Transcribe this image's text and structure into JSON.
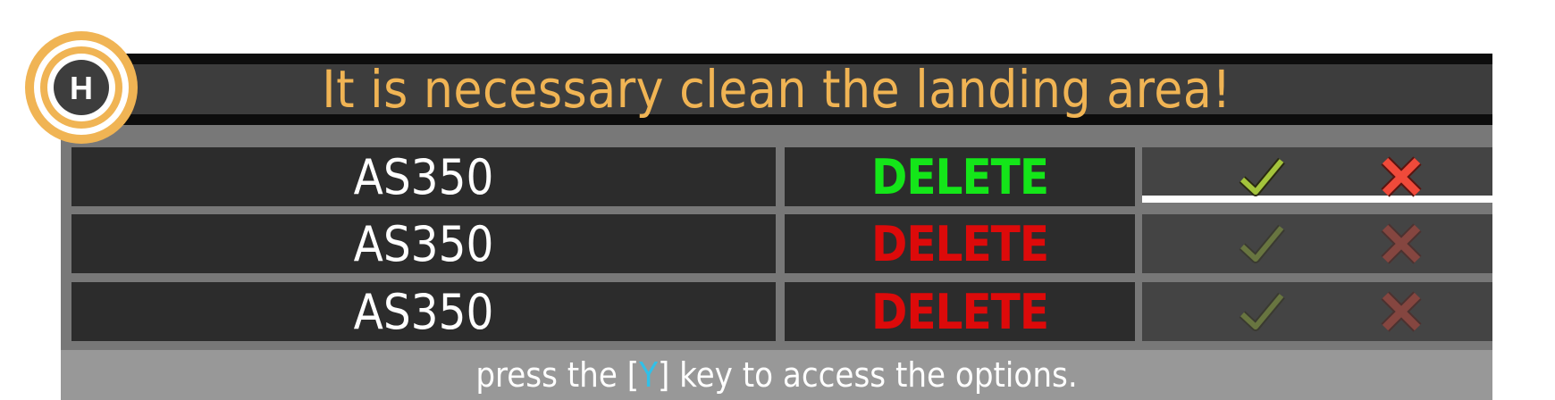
{
  "header": {
    "title": "It is necessary clean the landing area!",
    "logo_letter": "H",
    "logo_color": "#f0b454"
  },
  "rows": [
    {
      "name": "AS350",
      "action": "DELETE",
      "selected": true,
      "confirm_icon": "check-icon",
      "cancel_icon": "close-icon"
    },
    {
      "name": "AS350",
      "action": "DELETE",
      "selected": false,
      "confirm_icon": "check-icon",
      "cancel_icon": "close-icon"
    },
    {
      "name": "AS350",
      "action": "DELETE",
      "selected": false,
      "confirm_icon": "check-icon",
      "cancel_icon": "close-icon"
    }
  ],
  "footer": {
    "prefix": "press the ",
    "key_open": "[",
    "key": "Y",
    "key_close": "]",
    "suffix": " key to access the options."
  },
  "colors": {
    "title": "#f0b454",
    "delete_selected": "#14e619",
    "delete_idle": "#dd0a0a",
    "confirm": "#a4c43c",
    "cancel": "#f04a3a",
    "key_highlight": "#31c0e8"
  }
}
